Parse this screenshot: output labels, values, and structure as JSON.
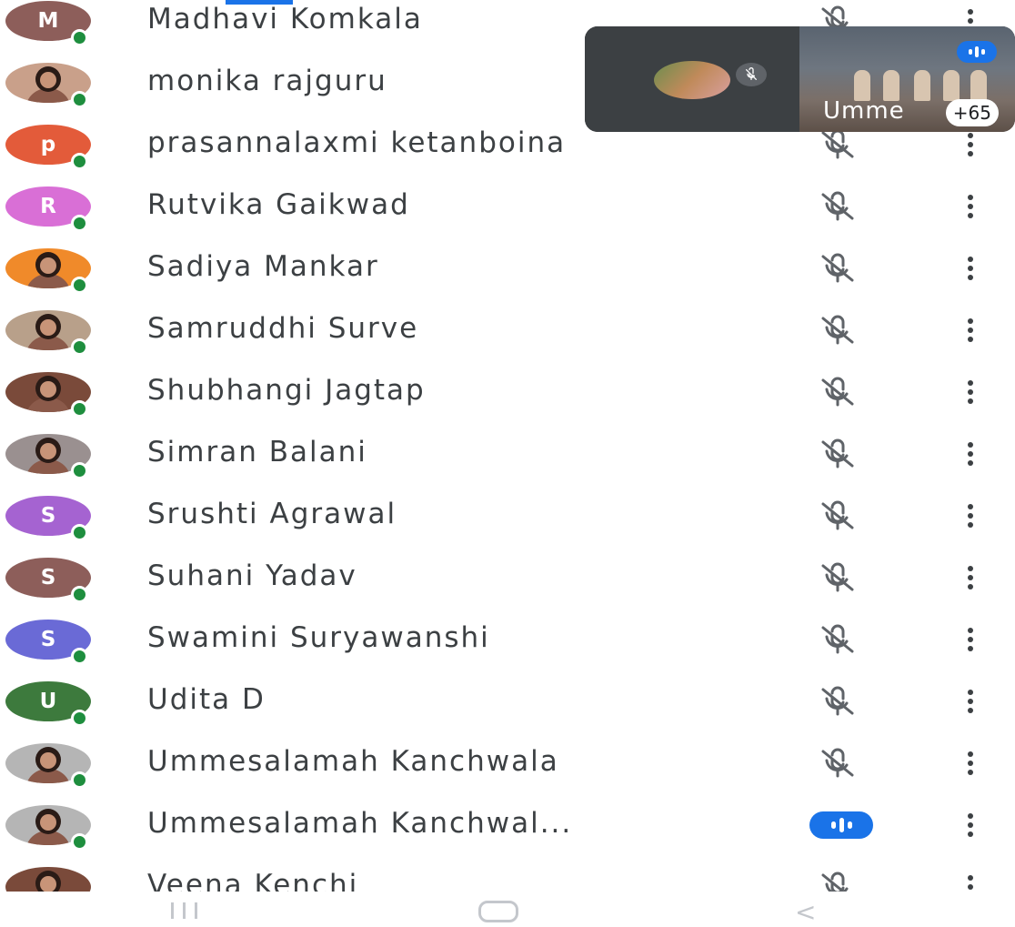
{
  "participants": [
    {
      "name": "Madhavi Komkala",
      "initial": "M",
      "color": "#8d5e5a",
      "avatar_type": "initial",
      "status": "muted"
    },
    {
      "name": "monika rajguru",
      "initial": "",
      "color": "#c9a08a",
      "avatar_type": "photo",
      "status": "muted"
    },
    {
      "name": "prasannalaxmi ketanboina",
      "initial": "p",
      "color": "#e35b3a",
      "avatar_type": "initial",
      "status": "muted"
    },
    {
      "name": "Rutvika Gaikwad",
      "initial": "R",
      "color": "#d96fd6",
      "avatar_type": "initial",
      "status": "muted"
    },
    {
      "name": "Sadiya Mankar",
      "initial": "",
      "color": "#f08a2a",
      "avatar_type": "photo",
      "status": "muted"
    },
    {
      "name": "Samruddhi Surve",
      "initial": "",
      "color": "#b8a08a",
      "avatar_type": "photo",
      "status": "muted"
    },
    {
      "name": "Shubhangi Jagtap",
      "initial": "",
      "color": "#7a4a3a",
      "avatar_type": "photo",
      "status": "muted"
    },
    {
      "name": "Simran Balani",
      "initial": "",
      "color": "#9a9090",
      "avatar_type": "photo",
      "status": "muted"
    },
    {
      "name": "Srushti Agrawal",
      "initial": "S",
      "color": "#a563d1",
      "avatar_type": "initial",
      "status": "muted"
    },
    {
      "name": "Suhani Yadav",
      "initial": "S",
      "color": "#8d5e5a",
      "avatar_type": "initial",
      "status": "muted"
    },
    {
      "name": "Swamini Suryawanshi",
      "initial": "S",
      "color": "#6a6ad6",
      "avatar_type": "initial",
      "status": "muted"
    },
    {
      "name": "Udita D",
      "initial": "U",
      "color": "#3d7a3d",
      "avatar_type": "initial",
      "status": "muted"
    },
    {
      "name": "Ummesalamah Kanchwala",
      "initial": "",
      "color": "#b5b5b5",
      "avatar_type": "photo",
      "status": "muted"
    },
    {
      "name": "Ummesalamah Kanchwal...",
      "initial": "",
      "color": "#b5b5b5",
      "avatar_type": "photo",
      "status": "speaking"
    },
    {
      "name": "Veena Kenchi",
      "initial": "",
      "color": "#7a4a3a",
      "avatar_type": "photo",
      "status": "muted"
    }
  ],
  "pip": {
    "speaker_name": "Umme",
    "extra_count": "+65",
    "mute_icon": "mic-off-icon",
    "speaking_icon": "audio-bars-icon"
  },
  "colors": {
    "accent": "#1a73e8",
    "online": "#1e8e3e",
    "text": "#3c4043"
  },
  "icons": {
    "row_muted": "mic-off-icon",
    "row_speaking": "audio-bars-icon",
    "row_menu": "more-vert-icon",
    "nav_recents": "recents-icon",
    "nav_home": "home-icon",
    "nav_back": "back-icon"
  }
}
